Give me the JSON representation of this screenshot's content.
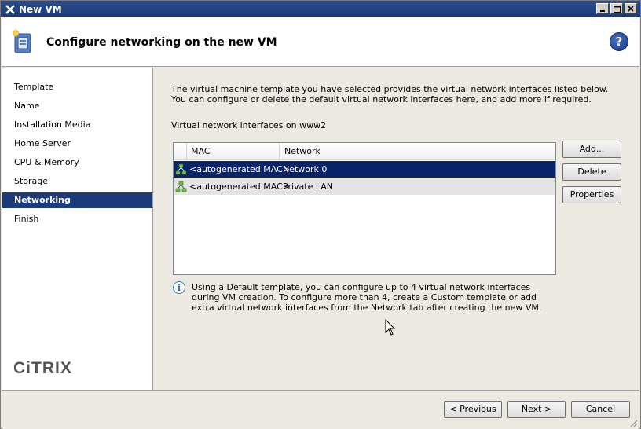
{
  "window": {
    "title": "New VM",
    "controls": {
      "minimize": "_",
      "maximize": "□",
      "close": "×"
    }
  },
  "header": {
    "title": "Configure networking on the new VM",
    "help_icon": "?"
  },
  "sidebar": {
    "items": [
      {
        "label": "Template",
        "active": false
      },
      {
        "label": "Name",
        "active": false
      },
      {
        "label": "Installation Media",
        "active": false
      },
      {
        "label": "Home Server",
        "active": false
      },
      {
        "label": "CPU & Memory",
        "active": false
      },
      {
        "label": "Storage",
        "active": false
      },
      {
        "label": "Networking",
        "active": true
      },
      {
        "label": "Finish",
        "active": false
      }
    ],
    "logo": "CiTRIX"
  },
  "main": {
    "description": "The virtual machine template you have selected provides the virtual network interfaces listed below. You can configure or delete the default virtual network interfaces here, and add more if required.",
    "list_label": "Virtual network interfaces on www2",
    "columns": {
      "mac": "MAC",
      "network": "Network"
    },
    "rows": [
      {
        "mac": "<autogenerated MAC>",
        "network": "Network 0",
        "selected": true
      },
      {
        "mac": "<autogenerated MAC>",
        "network": "Private LAN",
        "selected": false
      }
    ],
    "buttons": {
      "add": "Add...",
      "delete": "Delete",
      "properties": "Properties"
    },
    "info_icon": "i",
    "info_text": "Using a Default template, you can configure up to 4 virtual network interfaces during VM creation. To configure more than 4, create a Custom template or add extra virtual network interfaces from the Network tab after creating the new VM."
  },
  "footer": {
    "previous": "< Previous",
    "next": "Next >",
    "cancel": "Cancel"
  },
  "colors": {
    "title_bar": "#1c3a7a",
    "selection": "#0a246a",
    "nav_active": "#1c3b7a"
  }
}
